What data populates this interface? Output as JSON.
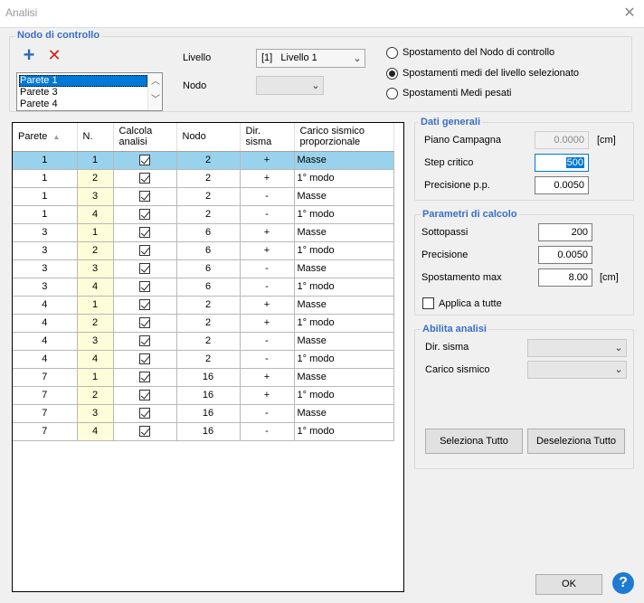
{
  "window": {
    "title": "Analisi",
    "close_glyph": "✕"
  },
  "control_node": {
    "group_label": "Nodo di controllo",
    "add_glyph": "+",
    "delete_glyph": "✕",
    "walls": [
      "Parete 1",
      "Parete 3",
      "Parete 4"
    ],
    "selected_wall": "Parete 1",
    "livello_label": "Livello",
    "livello_value": "[1]   Livello 1",
    "nodo_label": "Nodo",
    "nodo_value": "",
    "radio_options": [
      {
        "label": "Spostamento del Nodo di controllo",
        "checked": false
      },
      {
        "label": "Spostamenti medi del livello selezionato",
        "checked": true
      },
      {
        "label": "Spostamenti Medi pesati",
        "checked": false
      }
    ]
  },
  "grid": {
    "headers": [
      "Parete",
      "N.",
      "Calcola\nanalisi",
      "Nodo",
      "Dir.\nsisma",
      "Carico sismico\nproporzionale"
    ],
    "rows": [
      {
        "parete": "1",
        "n": "1",
        "calcola": true,
        "nodo": "2",
        "dir": "+",
        "carico": "Masse",
        "selected": true
      },
      {
        "parete": "1",
        "n": "2",
        "calcola": true,
        "nodo": "2",
        "dir": "+",
        "carico": "1° modo"
      },
      {
        "parete": "1",
        "n": "3",
        "calcola": true,
        "nodo": "2",
        "dir": "-",
        "carico": "Masse"
      },
      {
        "parete": "1",
        "n": "4",
        "calcola": true,
        "nodo": "2",
        "dir": "-",
        "carico": "1° modo"
      },
      {
        "parete": "3",
        "n": "1",
        "calcola": true,
        "nodo": "6",
        "dir": "+",
        "carico": "Masse"
      },
      {
        "parete": "3",
        "n": "2",
        "calcola": true,
        "nodo": "6",
        "dir": "+",
        "carico": "1° modo"
      },
      {
        "parete": "3",
        "n": "3",
        "calcola": true,
        "nodo": "6",
        "dir": "-",
        "carico": "Masse"
      },
      {
        "parete": "3",
        "n": "4",
        "calcola": true,
        "nodo": "6",
        "dir": "-",
        "carico": "1° modo"
      },
      {
        "parete": "4",
        "n": "1",
        "calcola": true,
        "nodo": "2",
        "dir": "+",
        "carico": "Masse"
      },
      {
        "parete": "4",
        "n": "2",
        "calcola": true,
        "nodo": "2",
        "dir": "+",
        "carico": "1° modo"
      },
      {
        "parete": "4",
        "n": "3",
        "calcola": true,
        "nodo": "2",
        "dir": "-",
        "carico": "Masse"
      },
      {
        "parete": "4",
        "n": "4",
        "calcola": true,
        "nodo": "2",
        "dir": "-",
        "carico": "1° modo"
      },
      {
        "parete": "7",
        "n": "1",
        "calcola": true,
        "nodo": "16",
        "dir": "+",
        "carico": "Masse"
      },
      {
        "parete": "7",
        "n": "2",
        "calcola": true,
        "nodo": "16",
        "dir": "+",
        "carico": "1° modo"
      },
      {
        "parete": "7",
        "n": "3",
        "calcola": true,
        "nodo": "16",
        "dir": "-",
        "carico": "Masse"
      },
      {
        "parete": "7",
        "n": "4",
        "calcola": true,
        "nodo": "16",
        "dir": "-",
        "carico": "1° modo"
      }
    ]
  },
  "dati_generali": {
    "label": "Dati generali",
    "piano_campagna_label": "Piano Campagna",
    "piano_campagna_value": "0.0000",
    "piano_campagna_unit": "[cm]",
    "step_critico_label": "Step critico",
    "step_critico_value": "500",
    "precisione_pp_label": "Precisione p.p.",
    "precisione_pp_value": "0.0050"
  },
  "parametri": {
    "label": "Parametri di calcolo",
    "sottopassi_label": "Sottopassi",
    "sottopassi_value": "200",
    "precisione_label": "Precisione",
    "precisione_value": "0.0050",
    "spostamento_label": "Spostamento max",
    "spostamento_value": "8.00",
    "spostamento_unit": "[cm]",
    "applica_label": "Applica a tutte",
    "applica_checked": false
  },
  "abilita": {
    "label": "Abilita analisi",
    "dir_sisma_label": "Dir. sisma",
    "carico_label": "Carico sismico",
    "seleziona_tutto": "Seleziona Tutto",
    "deseleziona_tutto": "Deseleziona Tutto"
  },
  "footer": {
    "ok_label": "OK",
    "help_glyph": "?"
  },
  "colors": {
    "group_title": "#3a6fc4",
    "selected_row": "#99d2ec",
    "n_column": "#fffdd9",
    "help": "#1e7bd1"
  }
}
